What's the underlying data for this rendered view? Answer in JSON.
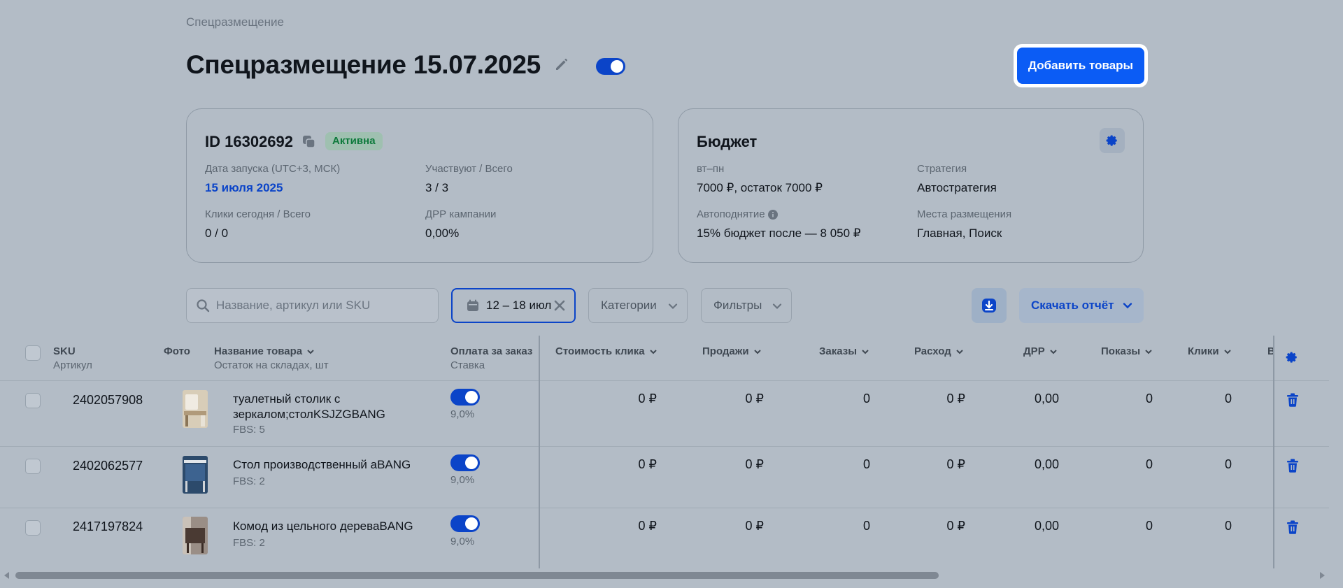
{
  "breadcrumb": "Спецразмещение",
  "title": "Спецразмещение 15.07.2025",
  "add_button": "Добавить товары",
  "campaign_card": {
    "id_label": "ID 16302692",
    "status": "Активна",
    "launch_label": "Дата запуска (UTC+3, МСК)",
    "launch_value": "15 июля 2025",
    "participate_label": "Участвуют / Всего",
    "participate_value": "3 / 3",
    "clicks_label": "Клики сегодня / Всего",
    "clicks_value": "0 / 0",
    "drr_label": "ДРР кампании",
    "drr_value": "0,00%"
  },
  "budget_card": {
    "title": "Бюджет",
    "period_label": "вт–пн",
    "period_value": "7000 ₽, остаток 7000 ₽",
    "strategy_label": "Стратегия",
    "strategy_value": "Автостратегия",
    "autoraise_label": "Автоподнятие",
    "autoraise_value": "15% бюджет после — 8 050 ₽",
    "places_label": "Места размещения",
    "places_value": "Главная, Поиск"
  },
  "toolbar": {
    "search_placeholder": "Название, артикул или SKU",
    "date_range": "12 – 18 июл",
    "categories": "Категории",
    "filters": "Фильтры",
    "download_report": "Скачать отчёт"
  },
  "table": {
    "headers": {
      "sku": "SKU",
      "article": "Артикул",
      "photo": "Фото",
      "name": "Название товара",
      "stock": "Остаток на складах, шт",
      "pay": "Оплата за заказ",
      "rate": "Ставка",
      "click_cost": "Стоимость клика",
      "sales": "Продажи",
      "orders": "Заказы",
      "spend": "Расход",
      "drr": "ДРР",
      "views": "Показы",
      "clicks": "Клики",
      "truncated": "В"
    },
    "rows": [
      {
        "sku": "2402057908",
        "name": "туалетный столик с зеркалом;столKSJZGBANG",
        "stock": "FBS: 5",
        "rate": "9,0%",
        "click_cost": "0 ₽",
        "sales": "0 ₽",
        "orders": "0",
        "spend": "0 ₽",
        "drr": "0,00",
        "views": "0",
        "clicks": "0"
      },
      {
        "sku": "2402062577",
        "name": "Стол производственный аBANG",
        "stock": "FBS: 2",
        "rate": "9,0%",
        "click_cost": "0 ₽",
        "sales": "0 ₽",
        "orders": "0",
        "spend": "0 ₽",
        "drr": "0,00",
        "views": "0",
        "clicks": "0"
      },
      {
        "sku": "2417197824",
        "name": "Комод из цельного дереваBANG",
        "stock": "FBS: 2",
        "rate": "9,0%",
        "click_cost": "0 ₽",
        "sales": "0 ₽",
        "orders": "0",
        "spend": "0 ₽",
        "drr": "0,00",
        "views": "0",
        "clicks": "0"
      }
    ]
  },
  "icons": {
    "edit": "pencil-icon",
    "copy": "copy-icon",
    "settings": "gear-icon",
    "info": "info-icon",
    "search": "search-icon",
    "calendar": "calendar-icon",
    "clear": "close-icon",
    "download": "download-icon",
    "delete": "trash-icon"
  },
  "colors": {
    "accent": "#0b5cf5",
    "toggle_on": "#0b44c8",
    "status_active": "#0e7a3c"
  }
}
